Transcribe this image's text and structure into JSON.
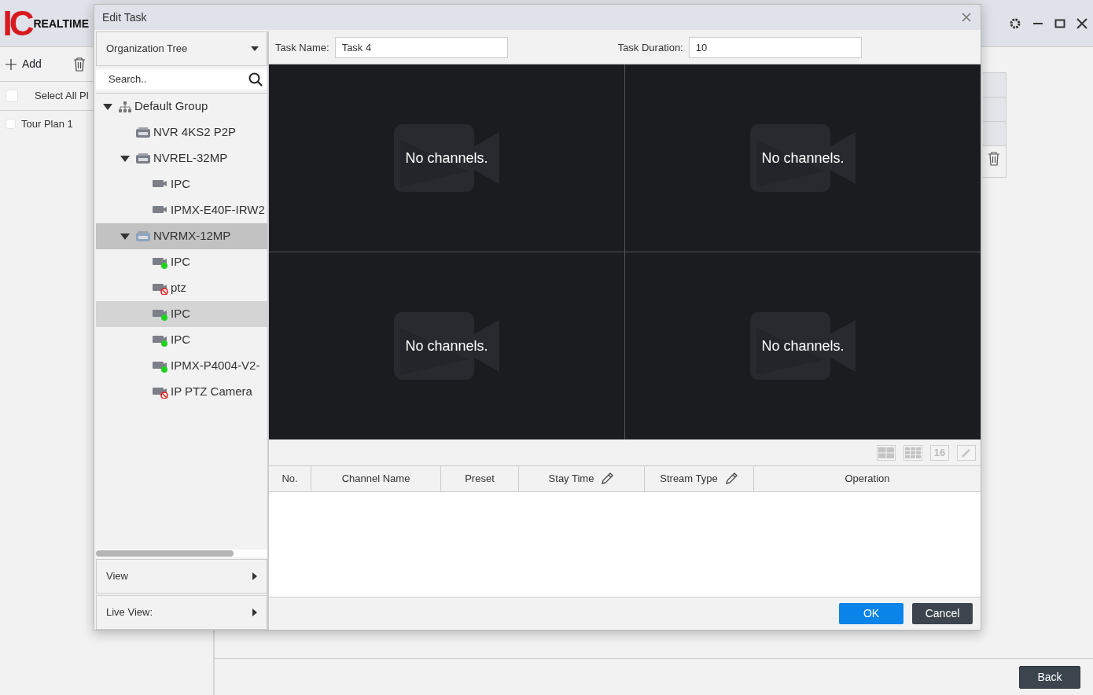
{
  "app": {
    "logo": {
      "mark": "IC",
      "word": "REALTIME"
    },
    "add_button": {
      "label": "Add"
    },
    "select_all": {
      "label": "Select All Pl",
      "checked": false
    },
    "plans": [
      {
        "label": "Tour Plan 1",
        "checked": false
      }
    ],
    "back_button": {
      "label": "Back"
    }
  },
  "dialog": {
    "title": "Edit Task",
    "tree_source": {
      "label": "Organization Tree"
    },
    "search": {
      "placeholder": "Search.."
    },
    "tree": [
      {
        "kind": "group",
        "label": "Default Group",
        "expanded": true,
        "selected": false,
        "hovered": false,
        "children": [
          {
            "kind": "recorder",
            "label": "NVR 4KS2 P2P",
            "selected": false,
            "hovered": false
          },
          {
            "kind": "recorder",
            "label": "NVREL-32MP",
            "expanded": true,
            "selected": false,
            "hovered": false,
            "children": [
              {
                "kind": "camera",
                "label": "IPC",
                "selected": false,
                "hovered": false
              },
              {
                "kind": "camera",
                "label": "IPMX-E40F-IRW2",
                "selected": false,
                "hovered": false
              }
            ]
          },
          {
            "kind": "recorder",
            "label": "NVRMX-12MP",
            "expanded": true,
            "selected": true,
            "hovered": false,
            "children": [
              {
                "kind": "camera",
                "label": "IPC",
                "online": true,
                "selected": false,
                "hovered": false
              },
              {
                "kind": "camera",
                "label": "ptz",
                "online": false,
                "selected": false,
                "hovered": false
              },
              {
                "kind": "camera",
                "label": "IPC",
                "online": true,
                "selected": false,
                "hovered": true
              },
              {
                "kind": "camera",
                "label": "IPC",
                "online": true,
                "selected": false,
                "hovered": false
              },
              {
                "kind": "camera",
                "label": "IPMX-P4004-V2-",
                "online": true,
                "selected": false,
                "hovered": false
              },
              {
                "kind": "camera",
                "label": "IP PTZ Camera",
                "online": false,
                "selected": false,
                "hovered": false
              }
            ]
          }
        ]
      }
    ],
    "menus": [
      {
        "label": "View"
      },
      {
        "label": "Live View:"
      }
    ],
    "task_name": {
      "label": "Task Name:",
      "value": "Task 4"
    },
    "task_duration": {
      "label": "Task Duration:",
      "value": "10"
    },
    "cells": [
      {
        "message": "No channels."
      },
      {
        "message": "No channels."
      },
      {
        "message": "No channels."
      },
      {
        "message": "No channels."
      }
    ],
    "layout_buttons": [
      {
        "kind": "grid4"
      },
      {
        "kind": "grid9"
      },
      {
        "kind": "text",
        "label": "16"
      },
      {
        "kind": "edit"
      }
    ],
    "columns": [
      {
        "label": "No.",
        "editable": false
      },
      {
        "label": "Channel Name",
        "editable": false
      },
      {
        "label": "Preset",
        "editable": false
      },
      {
        "label": "Stay Time",
        "editable": true
      },
      {
        "label": "Stream Type",
        "editable": true
      },
      {
        "label": "Operation",
        "editable": false
      }
    ],
    "buttons": [
      {
        "kind": "primary",
        "label": "OK"
      },
      {
        "kind": "secondary",
        "label": "Cancel"
      }
    ]
  }
}
